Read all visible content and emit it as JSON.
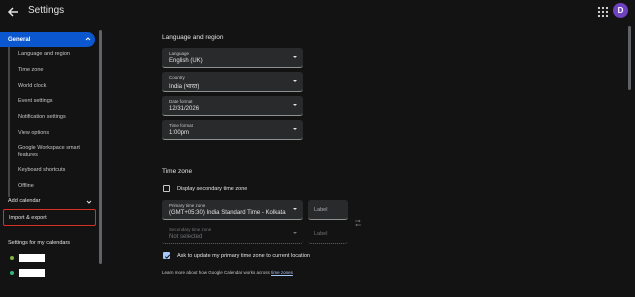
{
  "header": {
    "title": "Settings",
    "avatar_letter": "D",
    "avatar_color": "#6f43c0"
  },
  "sidebar": {
    "general_label": "General",
    "general_items": [
      "Language and region",
      "Time zone",
      "World clock",
      "Event settings",
      "Notification settings",
      "View options",
      "Google Workspace smart features",
      "Keyboard shortcuts",
      "Offline"
    ],
    "add_calendar_label": "Add calendar",
    "import_export_label": "Import & export",
    "my_calendars_title": "Settings for my calendars",
    "calendars": [
      {
        "color": "#7cb342"
      },
      {
        "color": "#33b679"
      }
    ]
  },
  "main": {
    "language_region": {
      "title": "Language and region",
      "fields": [
        {
          "label": "Language",
          "value": "English (UK)"
        },
        {
          "label": "Country",
          "value": "India (भारत)"
        },
        {
          "label": "Date format",
          "value": "12/31/2026"
        },
        {
          "label": "Time format",
          "value": "1:00pm"
        }
      ]
    },
    "time_zone": {
      "title": "Time zone",
      "secondary_checkbox_label": "Display secondary time zone",
      "primary": {
        "label": "Primary time zone",
        "value": "(GMT+05:30) India Standard Time - Kolkata",
        "tz_label_placeholder": "Label"
      },
      "secondary": {
        "label": "Secondary time zone",
        "value": "Not selected",
        "tz_label_placeholder": "Label"
      },
      "ask_update_label": "Ask to update my primary time zone to current location",
      "learn_more_text": "Learn more about how Google Calendar works across",
      "learn_more_link": "time zones"
    }
  },
  "colors": {
    "accent": "#0b57d0",
    "highlight_border": "#d93025",
    "background": "#131314"
  }
}
